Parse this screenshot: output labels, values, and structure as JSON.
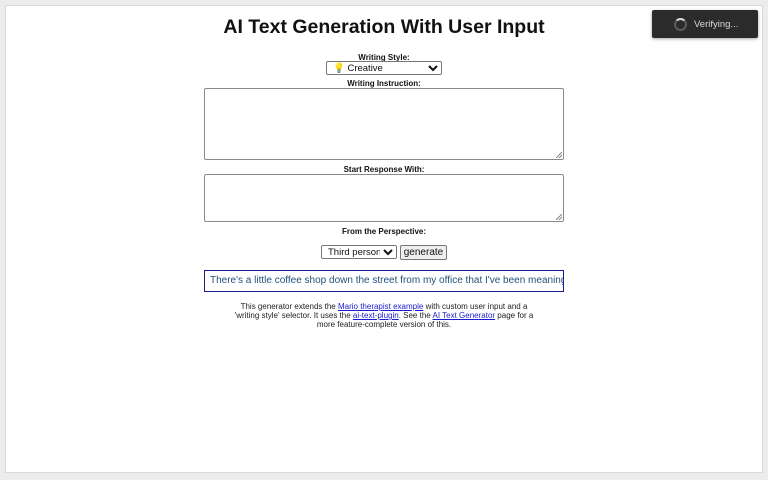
{
  "page": {
    "title": "AI Text Generation With User Input"
  },
  "writing_style": {
    "label": "Writing Style:",
    "selected": "💡 Creative",
    "options": [
      "💡 Creative"
    ]
  },
  "writing_instruction": {
    "label": "Writing Instruction:",
    "value": ""
  },
  "start_response": {
    "label": "Start Response With:",
    "value": ""
  },
  "perspective": {
    "label": "From the Perspective:",
    "selected": "Third person",
    "options": [
      "Third person"
    ]
  },
  "generate_button": {
    "label": "generate"
  },
  "output": {
    "text": "There's a little coffee shop down the street from my office that I've been meaning"
  },
  "description": {
    "part1": "This generator extends the ",
    "link1": "Mario therapist example",
    "part2": " with custom user input and a 'writing style' selector. It uses the ",
    "link2": "ai-text-plugin",
    "part3": ". See the ",
    "link3": "AI Text Generator",
    "part4": " page for a more feature-complete version of this."
  },
  "toast": {
    "text": "Verifying..."
  },
  "colors": {
    "output_border": "#1a1a8a",
    "output_text": "#23517a",
    "link": "#1a1ad0",
    "toast_bg": "#2b2b2b"
  }
}
